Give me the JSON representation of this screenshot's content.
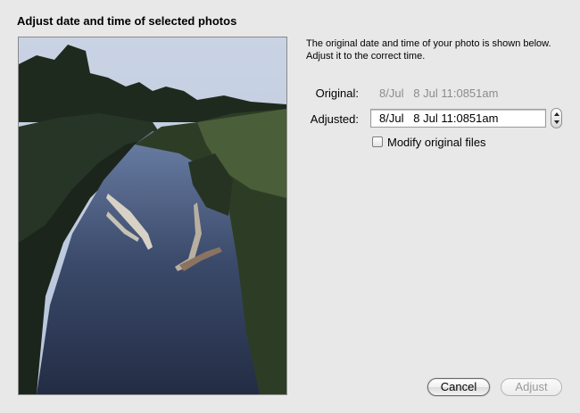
{
  "dialog": {
    "title": "Adjust date and time of selected photos",
    "instructions": "The original date and time of your photo is shown below. Adjust it to the correct time."
  },
  "fields": {
    "original_label": "Original:",
    "original_value": "8/Jul   8 Jul 11:0851am",
    "adjusted_label": "Adjusted:",
    "adjusted_value": "8/Jul   8 Jul 11:0851am"
  },
  "options": {
    "modify_original_label": "Modify original files",
    "modify_original_checked": false
  },
  "buttons": {
    "cancel_label": "Cancel",
    "adjust_label": "Adjust",
    "adjust_enabled": false
  },
  "icons": {
    "stepper": "stepper-icon"
  }
}
